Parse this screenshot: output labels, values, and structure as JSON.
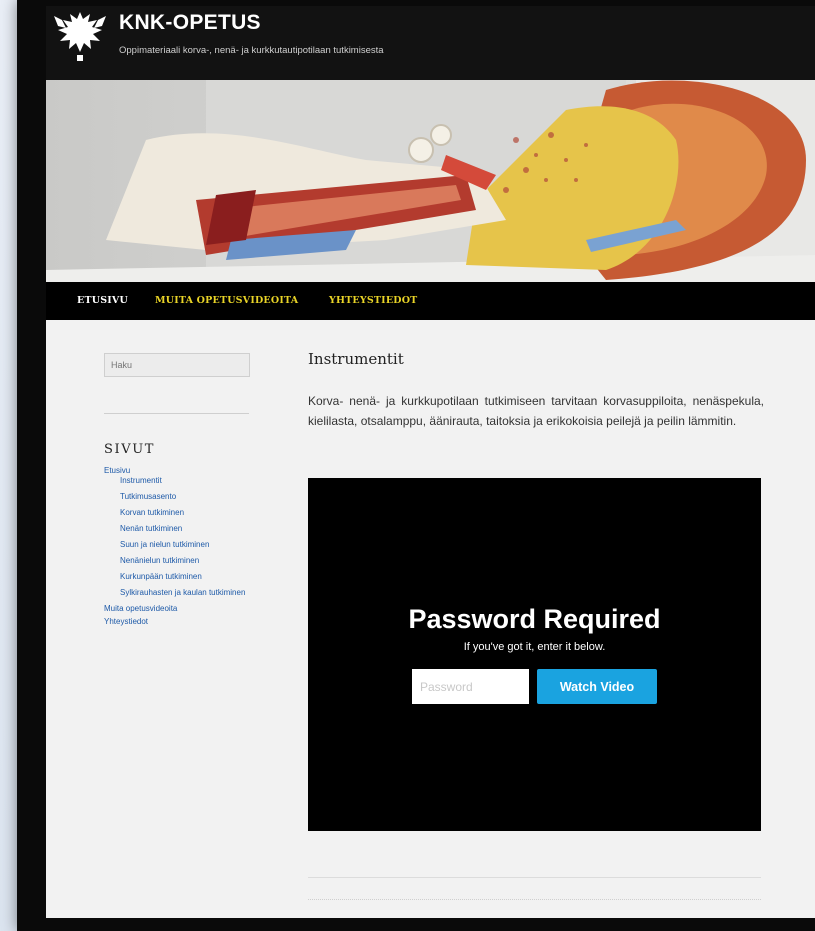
{
  "site": {
    "title": "KNK-OPETUS",
    "description": "Oppimateriaali korva-, nenä- ja kurkkutautipotilaan tutkimisesta"
  },
  "logo": {
    "icon": "university-helsinki-logo-icon"
  },
  "hero": {
    "image": "ear-anatomy-model-photo"
  },
  "nav": {
    "items": [
      {
        "label": "ETUSIVU"
      },
      {
        "label": "MUITA OPETUSVIDEOITA"
      },
      {
        "label": "YHTEYSTIEDOT"
      }
    ],
    "home_color": "#ffffff",
    "accent_color": "#e9d427"
  },
  "sidebar": {
    "search_placeholder": "Haku",
    "heading": "SIVUT",
    "pages": [
      {
        "label": "Etusivu"
      },
      {
        "label": "Instrumentit"
      },
      {
        "label": "Tutkimusasento"
      },
      {
        "label": "Korvan tutkiminen"
      },
      {
        "label": "Nenän tutkiminen"
      },
      {
        "label": "Suun ja nielun tutkiminen"
      },
      {
        "label": "Nenänielun tutkiminen"
      },
      {
        "label": "Kurkunpään tutkiminen"
      },
      {
        "label": "Sylkirauhasten ja kaulan tutkiminen"
      },
      {
        "label": "Muita opetusvideoita"
      },
      {
        "label": "Yhteystiedot"
      }
    ],
    "link_color": "#1e5aa8"
  },
  "main": {
    "title": "Instrumentit",
    "body": "Korva- nenä- ja kurkkupotilaan tutkimiseen tarvitaan korvasuppiloita, nenäspekula, kielilasta, otsalamppu, äänirauta, taitoksia ja erikokoisia peilejä ja peilin lämmitin."
  },
  "video": {
    "title": "Password Required",
    "subtitle": "If you've got it, enter it below.",
    "input_placeholder": "Password",
    "input_value": "",
    "button_label": "Watch Video",
    "button_color": "#1aa3e0"
  }
}
